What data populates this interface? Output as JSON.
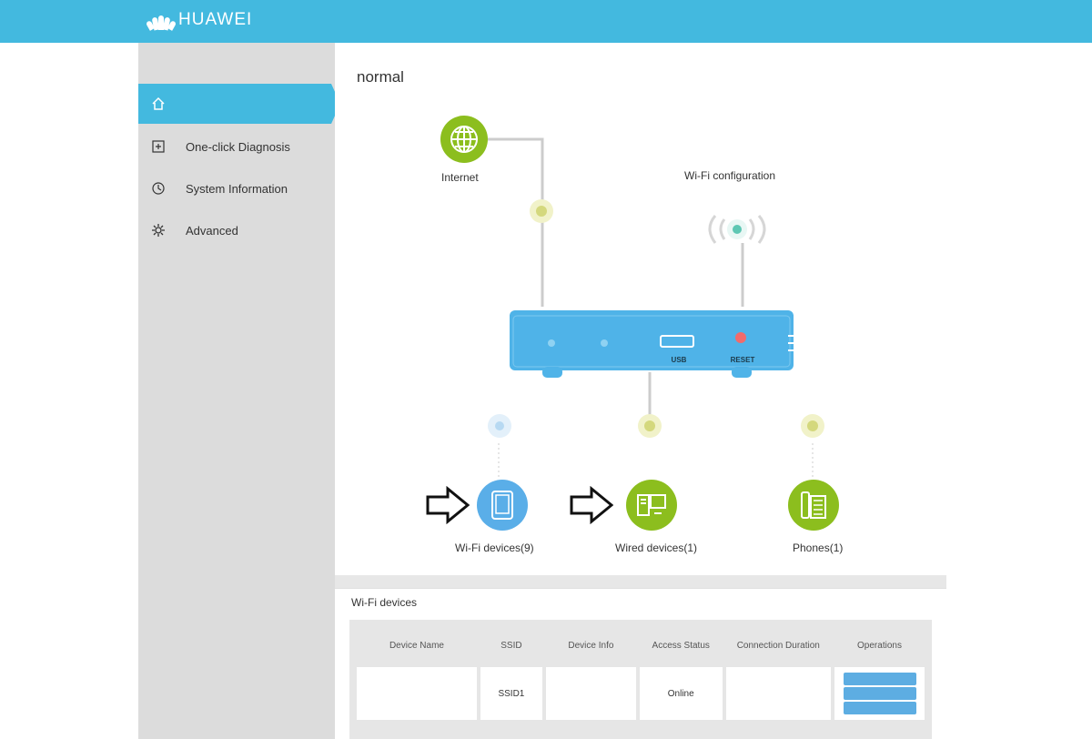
{
  "header": {
    "brand": "HUAWEI",
    "links": [
      "",
      "",
      ""
    ]
  },
  "sidebar": {
    "items": [
      {
        "label": "",
        "icon": "home-icon",
        "active": true
      },
      {
        "label": "One-click Diagnosis",
        "icon": "diagnosis-icon",
        "active": false
      },
      {
        "label": "System Information",
        "icon": "system-info-icon",
        "active": false
      },
      {
        "label": "Advanced",
        "icon": "gear-icon",
        "active": false
      }
    ]
  },
  "status": {
    "label": "",
    "value": "normal"
  },
  "topology": {
    "internet_label": "Internet",
    "wifi_config_label": "Wi-Fi configuration",
    "router_ports": {
      "usb": "USB",
      "reset": "RESET"
    },
    "devices": [
      {
        "label": "Wi-Fi devices(9)",
        "icon": "tablet-icon"
      },
      {
        "label": "Wired devices(1)",
        "icon": "computer-icon"
      },
      {
        "label": "Phones(1)",
        "icon": "phone-icon"
      }
    ]
  },
  "wifi_section": {
    "title": "Wi-Fi devices",
    "columns": [
      "Device Name",
      "SSID",
      "Device Info",
      "Access Status",
      "Connection Duration",
      "Operations"
    ],
    "rows": [
      {
        "name": "",
        "ssid": "SSID1",
        "info": "",
        "status": "Online",
        "duration": "",
        "operations": [
          "",
          "",
          ""
        ]
      }
    ]
  },
  "colors": {
    "header": "#43b9df",
    "sidebar": "#dcdcdc",
    "router": "#4fb3e8",
    "green": "#8cbe1e",
    "blue_device": "#5aaee8"
  }
}
